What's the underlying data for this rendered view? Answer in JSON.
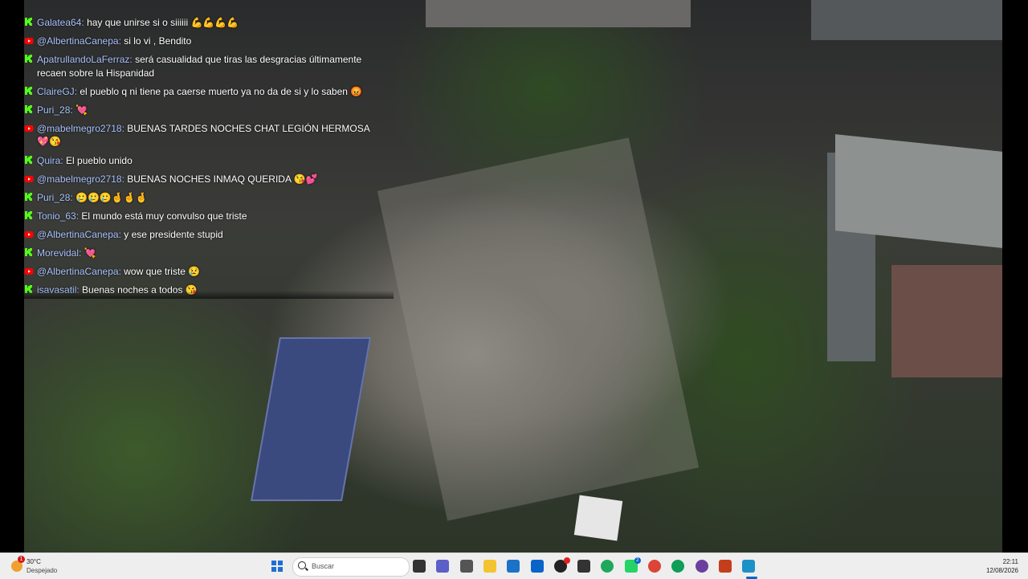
{
  "chat": {
    "messages": [
      {
        "platform": "kick",
        "user": "Galatea64",
        "text": "hay que unirse si o siiiiii",
        "emoji": "💪💪💪💪"
      },
      {
        "platform": "youtube",
        "user": "@AlbertinaCanepa",
        "text": "si lo vi , Bendito",
        "emoji": ""
      },
      {
        "platform": "kick",
        "user": "ApatrullandoLaFerraz",
        "text": "será casualidad que tiras las desgracias últimamente recaen sobre la Hispanidad",
        "emoji": ""
      },
      {
        "platform": "kick",
        "user": "ClaireGJ",
        "text": "el pueblo q ni tiene pa caerse muerto ya no da de si y lo saben",
        "emoji": "😡"
      },
      {
        "platform": "kick",
        "user": "Puri_28",
        "text": "",
        "emoji": "💘"
      },
      {
        "platform": "youtube",
        "user": "@mabelmegro2718",
        "text": "BUENAS TARDES NOCHES CHAT LEGIÓN HERMOSA",
        "emoji": "💖😘"
      },
      {
        "platform": "kick",
        "user": "Quira",
        "text": "El pueblo unido",
        "emoji": ""
      },
      {
        "platform": "youtube",
        "user": "@mabelmegro2718",
        "text": "BUENAS NOCHES INMAQ QUERIDA",
        "emoji": "😘💕"
      },
      {
        "platform": "kick",
        "user": "Puri_28",
        "text": "",
        "emoji": "🥲🥲🥲🤞🤞🤞"
      },
      {
        "platform": "kick",
        "user": "Tonio_63",
        "text": "El mundo está muy convulso que triste",
        "emoji": ""
      },
      {
        "platform": "youtube",
        "user": "@AlbertinaCanepa",
        "text": "y ese presidente stupid",
        "emoji": ""
      },
      {
        "platform": "kick",
        "user": "Morevidal",
        "text": "",
        "emoji": "💘"
      },
      {
        "platform": "youtube",
        "user": "@AlbertinaCanepa",
        "text": "wow que triste",
        "emoji": "😢"
      },
      {
        "platform": "kick",
        "user": "isavasatil",
        "text": "Buenas noches a todos",
        "emoji": "😘"
      }
    ]
  },
  "taskbar": {
    "weather_temp": "30°C",
    "weather_desc": "Despejado",
    "weather_badge": "1",
    "search_placeholder": "Buscar",
    "time": "22:11",
    "date": "12/08/2026",
    "whatsapp_badge": "2",
    "icons": [
      {
        "name": "task-view-icon",
        "color": "#333333"
      },
      {
        "name": "teams-icon",
        "color": "#5b5fc7"
      },
      {
        "name": "app-icon",
        "color": "#555555"
      },
      {
        "name": "file-explorer-icon",
        "color": "#f4c430"
      },
      {
        "name": "store-icon",
        "color": "#1a73c8"
      },
      {
        "name": "outlook-icon",
        "color": "#0a64c8"
      },
      {
        "name": "record-app-icon",
        "color": "#222222"
      },
      {
        "name": "cube-app-icon",
        "color": "#333333"
      },
      {
        "name": "edge-icon",
        "color": "#1fa85c"
      },
      {
        "name": "whatsapp-icon",
        "color": "#25d366"
      },
      {
        "name": "chrome-icon",
        "color": "#db4437"
      },
      {
        "name": "chrome-profile-icon",
        "color": "#0f9d58"
      },
      {
        "name": "obs-icon",
        "color": "#6b3fa0"
      },
      {
        "name": "powerpoint-icon",
        "color": "#c43e1c"
      },
      {
        "name": "streaming-app-icon",
        "color": "#1e90c8"
      }
    ]
  }
}
